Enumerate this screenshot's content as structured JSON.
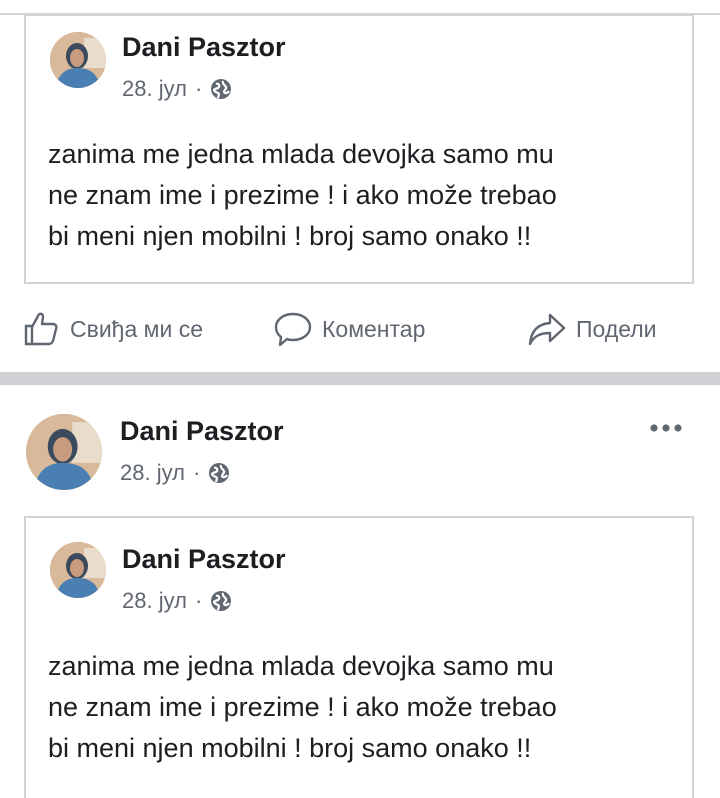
{
  "post1": {
    "shared": {
      "author": "Dani Pasztor",
      "date": "28. јул",
      "separator": "·",
      "privacy_icon": "globe-icon",
      "text_lines": [
        "zanima me jedna mlada devojka samo mu",
        "ne znam ime i prezime ! i ako može trebao",
        "bi meni njen mobilni ! broj samo onako !!"
      ]
    },
    "actions": {
      "like": {
        "label": "Свиђа ми се",
        "icon": "thumbs-up-icon"
      },
      "comment": {
        "label": "Коментар",
        "icon": "comment-icon"
      },
      "share": {
        "label": "Подели",
        "icon": "share-icon"
      }
    }
  },
  "post2": {
    "author": "Dani Pasztor",
    "date": "28. јул",
    "separator": "·",
    "privacy_icon": "globe-icon",
    "more_icon": "more-options-icon",
    "shared": {
      "author": "Dani Pasztor",
      "date": "28. јул",
      "separator": "·",
      "privacy_icon": "globe-icon",
      "text_lines": [
        "zanima me jedna mlada devojka samo mu",
        "ne znam ime i prezime ! i ako može trebao",
        "bi meni njen mobilni ! broj samo onako !!"
      ]
    }
  },
  "colors": {
    "text": "#1c1e21",
    "secondary": "#606770",
    "border": "#d0d3d8",
    "separator": "#ced0d4"
  }
}
